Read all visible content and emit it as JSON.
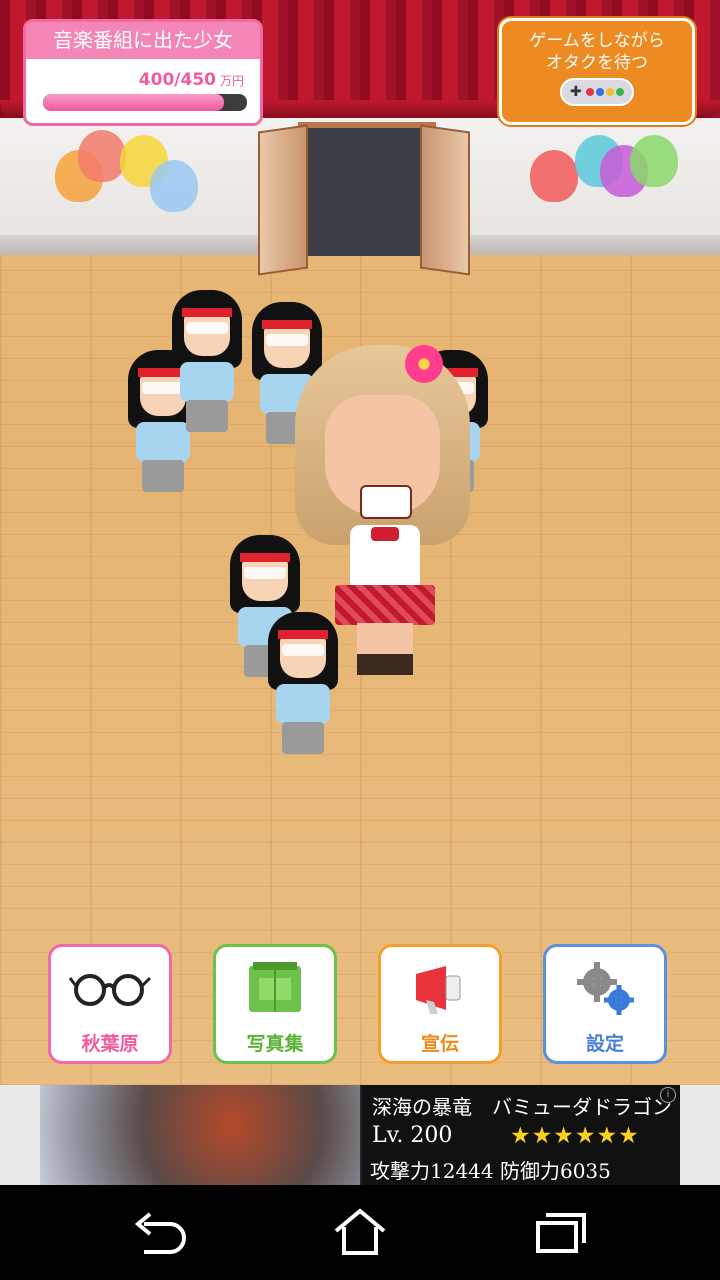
{
  "title_card": {
    "title": "音楽番組に出た少女",
    "amount": "400/450",
    "unit": "万円",
    "progress_fraction": 0.889
  },
  "game_button": {
    "line1": "ゲームをしながら",
    "line2": "オタクを待つ",
    "icon": "gamepad-icon"
  },
  "menu": {
    "akihabara": {
      "label": "秋葉原",
      "icon": "glasses-icon"
    },
    "photobook": {
      "label": "写真集",
      "icon": "book-icon"
    },
    "promotion": {
      "label": "宣伝",
      "icon": "megaphone-icon"
    },
    "settings": {
      "label": "設定",
      "icon": "gears-icon"
    }
  },
  "ad": {
    "title": "深海の暴竜　バミューダドラゴン",
    "level": "Lv. 200",
    "stars": "★★★★★★",
    "stats": "攻撃力12444 防御力6035",
    "close_icon": "close-icon"
  },
  "navbar": {
    "back_icon": "back-icon",
    "home_icon": "home-icon",
    "recents_icon": "recents-icon"
  },
  "colors": {
    "pink": "#ef5d9f",
    "orange": "#ee8a22",
    "green": "#6cc24a",
    "blue": "#5b8fe0"
  }
}
